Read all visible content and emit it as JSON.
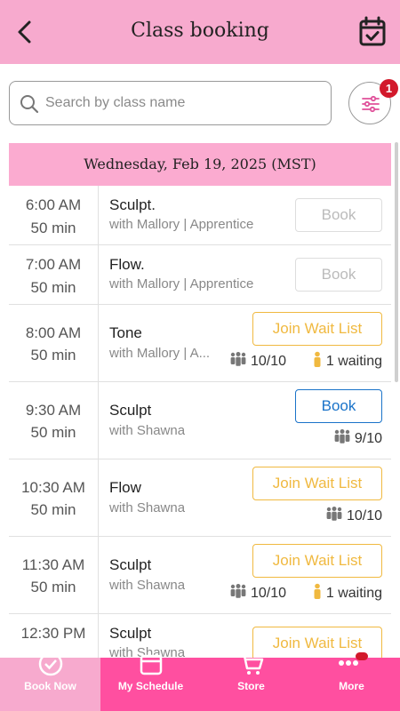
{
  "header": {
    "title": "Class booking",
    "back_icon": "chevron-left-icon",
    "calendar_icon": "calendar-check-icon"
  },
  "search": {
    "placeholder": "Search by class name",
    "filter_badge": "1"
  },
  "date_label": "Wednesday, Feb 19, 2025 (MST)",
  "classes": [
    {
      "time": "6:00  AM",
      "duration": "50 min",
      "name": "Sculpt.",
      "instructor": "with Mallory | Apprentice",
      "button": "Book",
      "button_state": "disabled",
      "spots": "",
      "waiting": ""
    },
    {
      "time": "7:00  AM",
      "duration": "50 min",
      "name": "Flow.",
      "instructor": "with Mallory | Apprentice",
      "button": "Book",
      "button_state": "disabled",
      "spots": "",
      "waiting": ""
    },
    {
      "time": "8:00  AM",
      "duration": "50 min",
      "name": "Tone",
      "instructor": "with Mallory | A...",
      "button": "Join Wait List",
      "button_state": "waitlist",
      "spots": "10/10",
      "waiting": "1 waiting"
    },
    {
      "time": "9:30  AM",
      "duration": "50 min",
      "name": "Sculpt",
      "instructor": "with Shawna",
      "button": "Book",
      "button_state": "book",
      "spots": "9/10",
      "waiting": ""
    },
    {
      "time": "10:30  AM",
      "duration": "50 min",
      "name": "Flow",
      "instructor": "with Shawna",
      "button": "Join Wait List",
      "button_state": "waitlist",
      "spots": "10/10",
      "waiting": ""
    },
    {
      "time": "11:30  AM",
      "duration": "50 min",
      "name": "Sculpt",
      "instructor": "with Shawna",
      "button": "Join Wait List",
      "button_state": "waitlist",
      "spots": "10/10",
      "waiting": "1 waiting"
    },
    {
      "time": "12:30  PM",
      "duration": "",
      "name": "Sculpt",
      "instructor": "with Shawna",
      "button": "Join Wait List",
      "button_state": "waitlist",
      "spots": "",
      "waiting": ""
    }
  ],
  "tabs": [
    {
      "label": "Book Now",
      "icon": "check-circle-icon",
      "active": true
    },
    {
      "label": "My Schedule",
      "icon": "calendar-icon",
      "active": false
    },
    {
      "label": "Store",
      "icon": "cart-icon",
      "active": false
    },
    {
      "label": "More",
      "icon": "more-icon",
      "active": false
    }
  ],
  "colors": {
    "header": "#f7aace",
    "tabbar": "#ff4fa0",
    "book": "#1a73c9",
    "waitlist": "#f0b940",
    "badge": "#d2192b"
  }
}
